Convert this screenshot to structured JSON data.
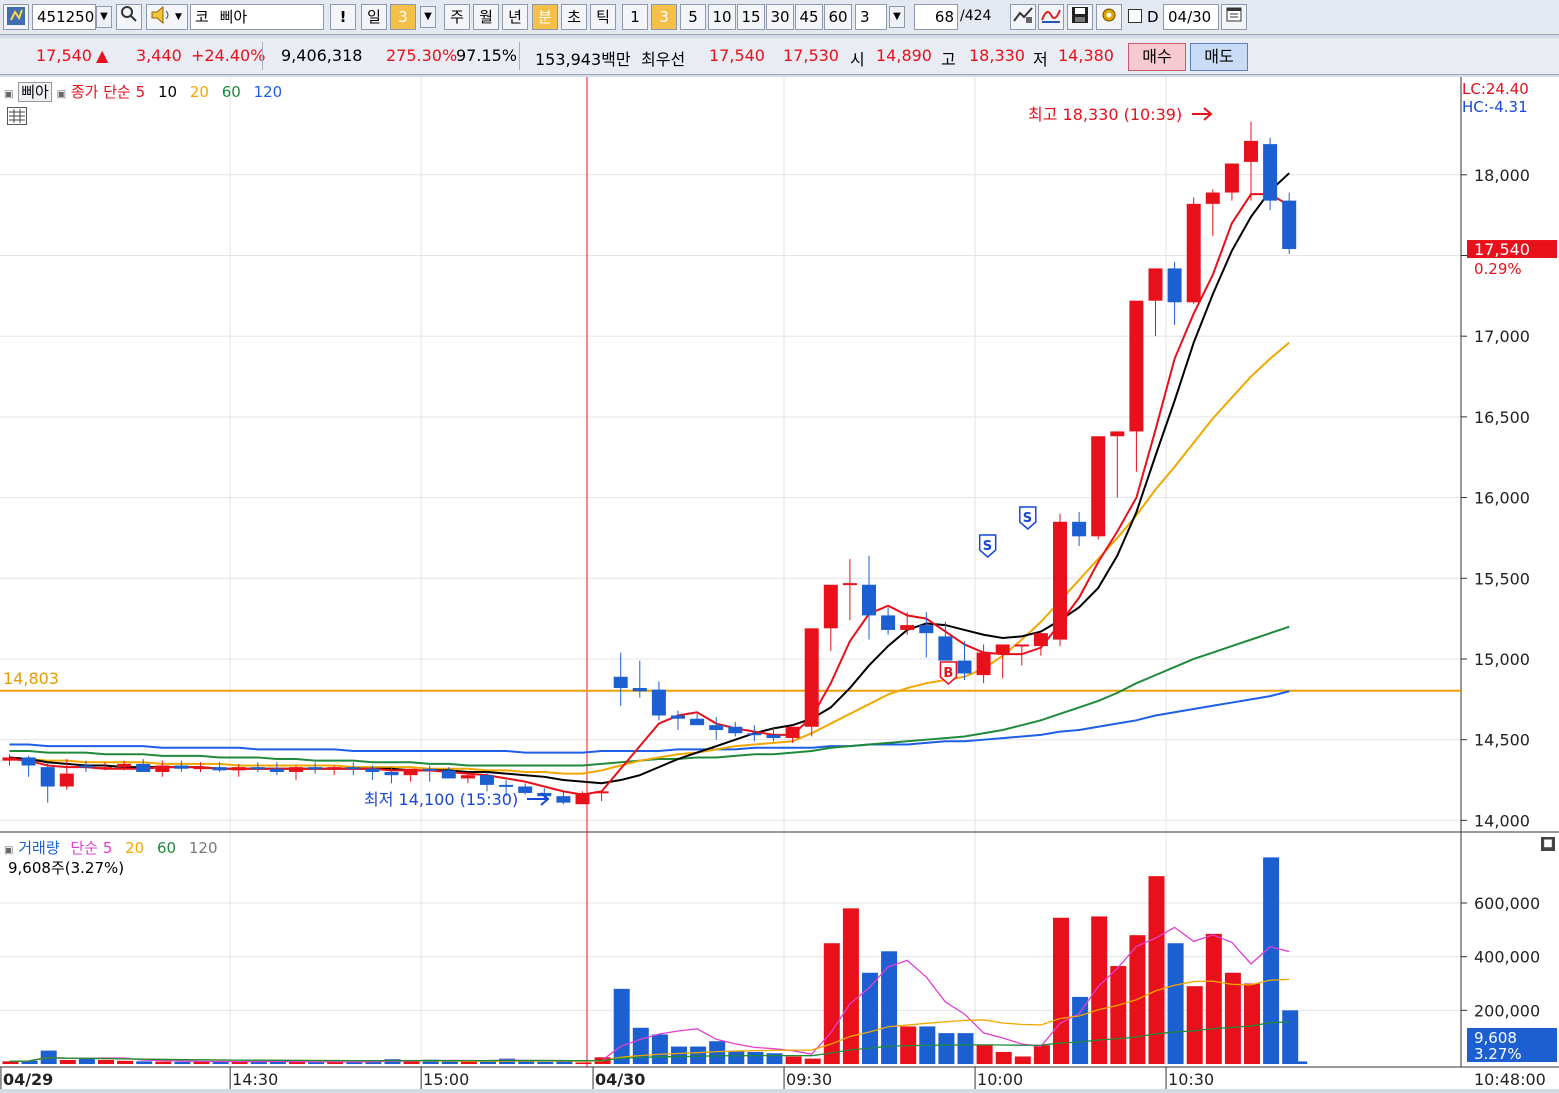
{
  "toolbar": {
    "code": "451250",
    "market_prefix": "코",
    "stock_name": "삐아",
    "alert_label": "!",
    "period_day": "일",
    "period_day_n": "3",
    "period_week": "주",
    "period_month": "월",
    "period_year": "년",
    "period_min": "분",
    "period_sec": "초",
    "period_tick": "틱",
    "intervals": [
      "1",
      "3",
      "5",
      "10",
      "15",
      "30",
      "45",
      "60"
    ],
    "custom_interval": "3",
    "count_value": "68",
    "count_total": "/424",
    "date_checkbox_label": "D",
    "date_value": "04/30"
  },
  "quote": {
    "price": "17,540",
    "arrow": "▲",
    "change": "3,440",
    "change_pct": "+24.40%",
    "volume": "9,406,318",
    "volume_ratio": "275.30%",
    "strength": "97.15%",
    "amount": "153,943백만",
    "best_label": "최우선",
    "ask": "17,540",
    "bid": "17,530",
    "open_label": "시",
    "open": "14,890",
    "high_label": "고",
    "high": "18,330",
    "low_label": "저",
    "low": "14,380",
    "buy_label": "매수",
    "sell_label": "매도"
  },
  "chart": {
    "legend_name": "삐아",
    "legend_ma_label": "종가 단순",
    "ma_periods": [
      "5",
      "10",
      "20",
      "60",
      "120"
    ],
    "ma_colors": [
      "#e8101a",
      "#000000",
      "#f0a800",
      "#1f8a3c",
      "#1e5ee8"
    ],
    "lc_label": "LC:24.40",
    "hc_label": "HC:-4.31",
    "high_annotation": "최고 18,330 (10:39)",
    "low_annotation": "최저 14,100 (15:30)",
    "hline_label": "14,803",
    "last_price_tag": "17,540",
    "last_pct_tag": "0.29%",
    "price_ticks": [
      "18,000",
      "17,000",
      "16,500",
      "16,000",
      "15,500",
      "15,000",
      "14,500",
      "14,000"
    ],
    "volume_legend_name": "거래량",
    "volume_legend_ma": "단순",
    "volume_ma_periods": [
      "5",
      "20",
      "60",
      "120"
    ],
    "volume_info": "9,608주(3.27%)",
    "volume_ticks": [
      "600,000",
      "400,000",
      "200,000"
    ],
    "volume_last_tag": "9,608",
    "volume_last_pct": "3.27%",
    "time_labels": [
      "04/29",
      "14:30",
      "15:00",
      "04/30",
      "09:30",
      "10:00",
      "10:30"
    ],
    "time_readout": "10:48:00",
    "signal_sell": "S",
    "signal_buy": "B"
  },
  "chart_data": {
    "type": "candlestick",
    "categories": [
      "c01",
      "c02",
      "c03",
      "c04",
      "c05",
      "c06",
      "c07",
      "c08",
      "c09",
      "c10",
      "c11",
      "c12",
      "c13",
      "c14",
      "c15",
      "c16",
      "c17",
      "c18",
      "c19",
      "c20",
      "c21",
      "c22",
      "c23",
      "c24",
      "c25",
      "c26",
      "c27",
      "c28",
      "c29",
      "c30",
      "c31",
      "c32",
      "c33",
      "c34",
      "c35",
      "c36",
      "c37",
      "c38",
      "c39",
      "c40",
      "c41",
      "c42",
      "c43",
      "c44",
      "c45",
      "c46",
      "c47",
      "c48",
      "c49",
      "c50",
      "c51",
      "c52",
      "c53",
      "c54",
      "c55",
      "c56",
      "c57",
      "c58",
      "c59",
      "c60",
      "c61",
      "c62",
      "c63",
      "c64",
      "c65",
      "c66",
      "c67",
      "c68"
    ],
    "open": [
      14370,
      14390,
      14330,
      14210,
      14340,
      14330,
      14330,
      14350,
      14300,
      14340,
      14320,
      14330,
      14310,
      14330,
      14320,
      14300,
      14330,
      14320,
      14330,
      14320,
      14300,
      14280,
      14320,
      14310,
      14260,
      14280,
      14220,
      14210,
      14170,
      14150,
      14100,
      14170,
      14890,
      14820,
      14810,
      14650,
      14630,
      14590,
      14580,
      14540,
      14530,
      14510,
      14580,
      15190,
      15460,
      15460,
      15270,
      15180,
      15210,
      15140,
      14990,
      14900,
      15030,
      15080,
      15080,
      15120,
      15850,
      15760,
      16380,
      16410,
      17220,
      17420,
      17210,
      17820,
      17890,
      18080,
      18190,
      17840
    ],
    "high": [
      14410,
      14400,
      14360,
      14380,
      14370,
      14360,
      14370,
      14380,
      14370,
      14370,
      14360,
      14360,
      14350,
      14360,
      14360,
      14340,
      14360,
      14340,
      14360,
      14340,
      14330,
      14300,
      14340,
      14330,
      14300,
      14300,
      14250,
      14230,
      14200,
      14180,
      14180,
      14180,
      15040,
      14990,
      14860,
      14680,
      14660,
      14640,
      14610,
      14590,
      14580,
      14550,
      14600,
      15420,
      15620,
      15640,
      15320,
      15290,
      15290,
      15230,
      15110,
      15090,
      15090,
      15090,
      15160,
      15900,
      15910,
      15820,
      16380,
      16600,
      17260,
      17460,
      17860,
      17910,
      18070,
      18330,
      18230,
      17890
    ],
    "low": [
      14340,
      14270,
      14110,
      14190,
      14300,
      14310,
      14310,
      14300,
      14270,
      14300,
      14300,
      14300,
      14270,
      14300,
      14280,
      14250,
      14290,
      14280,
      14280,
      14250,
      14230,
      14240,
      14240,
      14260,
      14230,
      14180,
      14150,
      14160,
      14130,
      14100,
      14120,
      14120,
      14710,
      14760,
      14620,
      14560,
      14590,
      14500,
      14520,
      14490,
      14490,
      14480,
      14520,
      15050,
      15240,
      15120,
      15150,
      15150,
      15010,
      14990,
      14870,
      14850,
      14880,
      14960,
      15020,
      15080,
      15700,
      15740,
      16000,
      16160,
      17000,
      17070,
      17200,
      17620,
      17840,
      17840,
      17780,
      17510
    ],
    "close": [
      14390,
      14340,
      14210,
      14290,
      14330,
      14330,
      14350,
      14300,
      14340,
      14320,
      14330,
      14310,
      14330,
      14320,
      14300,
      14330,
      14320,
      14330,
      14320,
      14300,
      14280,
      14320,
      14310,
      14260,
      14280,
      14220,
      14210,
      14170,
      14150,
      14110,
      14170,
      14180,
      14820,
      14800,
      14650,
      14630,
      14590,
      14560,
      14540,
      14530,
      14510,
      14580,
      15190,
      15460,
      15470,
      15270,
      15180,
      15210,
      15160,
      14990,
      14910,
      15040,
      15090,
      15090,
      15160,
      15850,
      15760,
      16380,
      16410,
      17220,
      17420,
      17210,
      17820,
      17890,
      18070,
      18210,
      17840,
      17540
    ],
    "volume": [
      10000,
      12000,
      50000,
      15000,
      20000,
      15000,
      12000,
      10000,
      9000,
      8000,
      10000,
      9000,
      8000,
      10000,
      9000,
      8000,
      7000,
      8000,
      7000,
      12000,
      18000,
      10000,
      16000,
      12000,
      9000,
      15000,
      20000,
      12000,
      8000,
      10000,
      6000,
      25000,
      280000,
      135000,
      110000,
      65000,
      65000,
      85000,
      50000,
      45000,
      40000,
      28000,
      20000,
      450000,
      580000,
      340000,
      420000,
      140000,
      140000,
      115000,
      115000,
      70000,
      45000,
      28000,
      70000,
      545000,
      250000,
      550000,
      365000,
      480000,
      700000,
      450000,
      290000,
      485000,
      340000,
      300000,
      770000,
      200000,
      9608
    ],
    "ma5": [
      14380,
      14370,
      14340,
      14330,
      14330,
      14320,
      14320,
      14320,
      14330,
      14330,
      14330,
      14320,
      14320,
      14320,
      14320,
      14320,
      14320,
      14320,
      14320,
      14320,
      14310,
      14310,
      14310,
      14300,
      14290,
      14280,
      14260,
      14240,
      14210,
      14180,
      14160,
      14180,
      14320,
      14460,
      14600,
      14650,
      14670,
      14600,
      14570,
      14550,
      14530,
      14530,
      14640,
      14850,
      15110,
      15280,
      15330,
      15270,
      15250,
      15170,
      15090,
      15040,
      15030,
      15030,
      15070,
      15220,
      15380,
      15600,
      15790,
      16000,
      16420,
      16860,
      17140,
      17380,
      17700,
      17880,
      17880,
      17810
    ],
    "ma10": [
      14390,
      14380,
      14360,
      14350,
      14340,
      14340,
      14330,
      14330,
      14330,
      14330,
      14330,
      14320,
      14320,
      14320,
      14320,
      14320,
      14320,
      14320,
      14320,
      14320,
      14320,
      14310,
      14310,
      14310,
      14300,
      14300,
      14290,
      14280,
      14270,
      14250,
      14240,
      14230,
      14250,
      14280,
      14330,
      14380,
      14420,
      14460,
      14500,
      14540,
      14570,
      14590,
      14630,
      14700,
      14820,
      14960,
      15080,
      15180,
      15220,
      15210,
      15180,
      15150,
      15130,
      15140,
      15170,
      15240,
      15320,
      15440,
      15640,
      15910,
      16260,
      16600,
      16960,
      17260,
      17530,
      17740,
      17900,
      18010
    ],
    "ma20": [
      14380,
      14380,
      14370,
      14370,
      14360,
      14360,
      14360,
      14360,
      14350,
      14350,
      14350,
      14350,
      14340,
      14340,
      14340,
      14340,
      14340,
      14340,
      14330,
      14330,
      14330,
      14330,
      14320,
      14320,
      14320,
      14310,
      14310,
      14300,
      14300,
      14290,
      14290,
      14310,
      14340,
      14370,
      14390,
      14410,
      14420,
      14440,
      14460,
      14470,
      14480,
      14490,
      14540,
      14600,
      14660,
      14720,
      14780,
      14820,
      14850,
      14870,
      14890,
      14940,
      15020,
      15120,
      15230,
      15360,
      15490,
      15620,
      15750,
      15890,
      16050,
      16190,
      16340,
      16490,
      16620,
      16750,
      16860,
      16960
    ],
    "ma60": [
      14430,
      14430,
      14420,
      14420,
      14420,
      14410,
      14410,
      14410,
      14400,
      14400,
      14400,
      14390,
      14390,
      14390,
      14380,
      14380,
      14370,
      14370,
      14370,
      14360,
      14360,
      14360,
      14350,
      14350,
      14340,
      14340,
      14340,
      14340,
      14340,
      14340,
      14340,
      14350,
      14360,
      14370,
      14380,
      14380,
      14390,
      14390,
      14400,
      14410,
      14410,
      14420,
      14430,
      14450,
      14460,
      14470,
      14480,
      14490,
      14500,
      14510,
      14520,
      14540,
      14560,
      14590,
      14620,
      14660,
      14700,
      14740,
      14790,
      14850,
      14900,
      14950,
      15000,
      15040,
      15080,
      15120,
      15160,
      15200
    ],
    "ma120": [
      14470,
      14470,
      14460,
      14460,
      14460,
      14460,
      14460,
      14460,
      14450,
      14450,
      14450,
      14450,
      14450,
      14440,
      14440,
      14440,
      14440,
      14440,
      14430,
      14430,
      14430,
      14430,
      14430,
      14430,
      14430,
      14430,
      14430,
      14420,
      14420,
      14420,
      14420,
      14430,
      14430,
      14430,
      14430,
      14440,
      14440,
      14440,
      14440,
      14450,
      14450,
      14450,
      14450,
      14460,
      14460,
      14470,
      14470,
      14470,
      14480,
      14490,
      14490,
      14500,
      14510,
      14520,
      14530,
      14550,
      14560,
      14580,
      14600,
      14620,
      14650,
      14670,
      14690,
      14710,
      14730,
      14750,
      14770,
      14800
    ],
    "ylim": [
      13990,
      18420
    ],
    "volume_ylim": [
      0,
      790000
    ]
  },
  "colors": {
    "up": "#e8101a",
    "down": "#1c5fd0",
    "hline": "#f0a000",
    "vol_ma5": "#e23ed2",
    "vol_ma20": "#f0a800",
    "vol_ma60": "#1f8a3c"
  }
}
